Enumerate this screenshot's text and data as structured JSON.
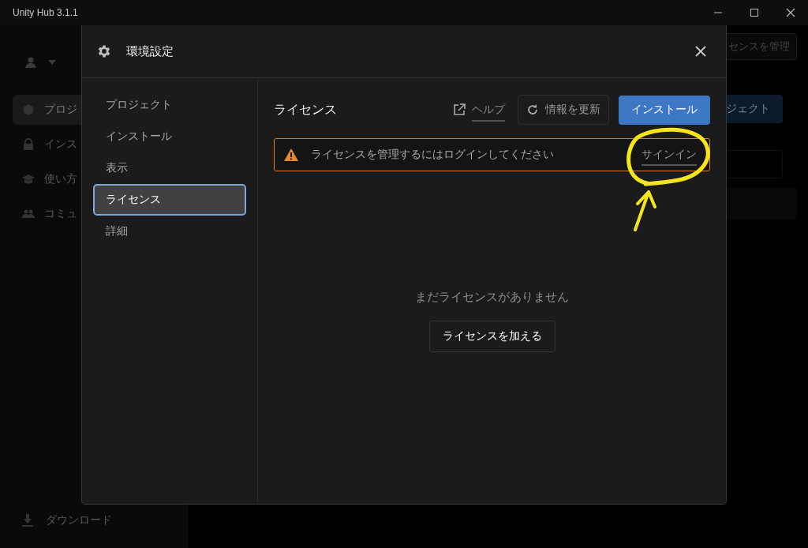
{
  "window": {
    "title": "Unity Hub 3.1.1"
  },
  "background": {
    "sidebar": {
      "items": [
        {
          "label": "プロジ",
          "selected": true
        },
        {
          "label": "インス",
          "selected": false
        },
        {
          "label": "使い方",
          "selected": false
        },
        {
          "label": "コミュ",
          "selected": false
        }
      ],
      "footer": "ダウンロード"
    },
    "main": {
      "manage_button": "センスを管理",
      "new_button": "ジェクト"
    }
  },
  "dialog": {
    "title": "環境設定",
    "nav": [
      {
        "label": "プロジェクト",
        "selected": false
      },
      {
        "label": "インストール",
        "selected": false
      },
      {
        "label": "表示",
        "selected": false
      },
      {
        "label": "ライセンス",
        "selected": true
      },
      {
        "label": "詳細",
        "selected": false
      }
    ],
    "page": {
      "title": "ライセンス",
      "help": "ヘルプ",
      "refresh": "情報を更新",
      "install": "インストール",
      "alert": {
        "message": "ライセンスを管理するにはログインしてください",
        "action": "サインイン"
      },
      "empty": {
        "message": "まだライセンスがありません",
        "button": "ライセンスを加える"
      }
    }
  }
}
